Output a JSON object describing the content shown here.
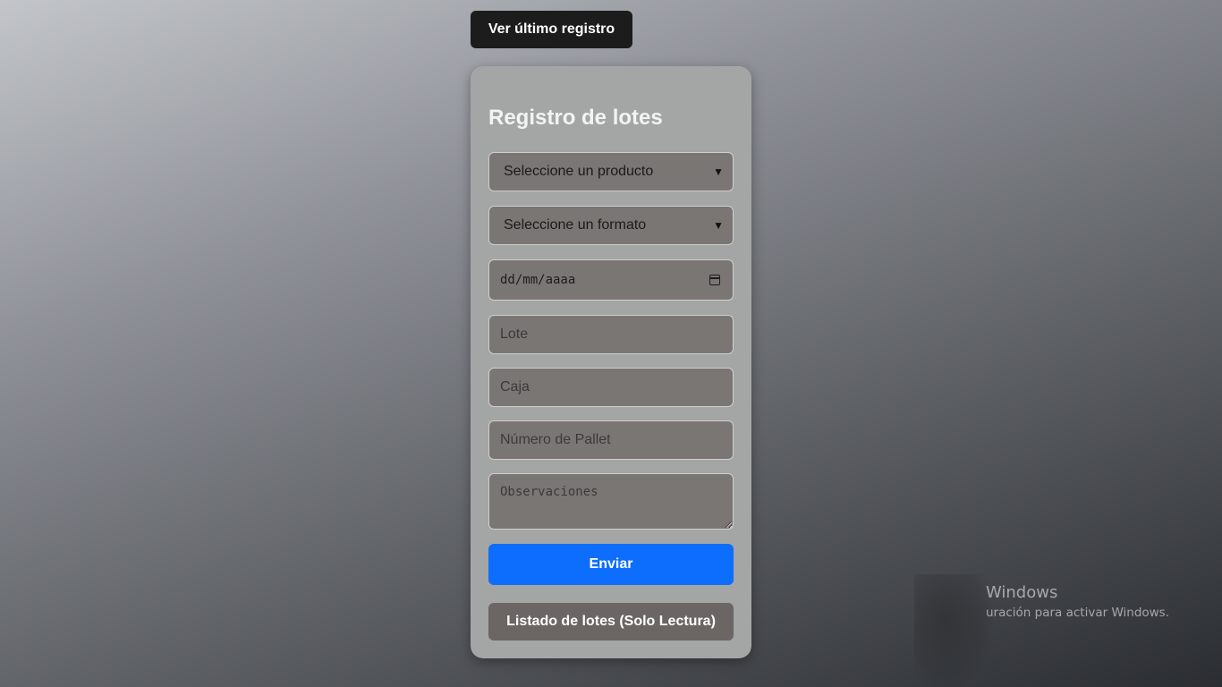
{
  "header": {
    "last_record_label": "Ver último registro"
  },
  "form": {
    "title": "Registro de lotes",
    "product_select": {
      "selected": "Seleccione un producto"
    },
    "format_select": {
      "selected": "Seleccione un formato"
    },
    "date": {
      "placeholder": "dd/mm/aaaa"
    },
    "lote": {
      "placeholder": "Lote",
      "value": ""
    },
    "caja": {
      "placeholder": "Caja",
      "value": ""
    },
    "pallet": {
      "placeholder": "Número de Pallet",
      "value": ""
    },
    "observaciones": {
      "placeholder": "Observaciones",
      "value": ""
    },
    "submit_label": "Enviar",
    "list_label": "Listado de lotes (Solo Lectura)"
  },
  "watermark": {
    "title": "Windows",
    "subtitle": "uración para activar Windows."
  },
  "colors": {
    "submit": "#0d6efd",
    "dark_button": "#1c1c1c",
    "card": "#a4a5a5",
    "field": "#7a7674"
  },
  "icons": {
    "select_arrow": "chevron-down-icon",
    "date_picker": "calendar-icon"
  }
}
